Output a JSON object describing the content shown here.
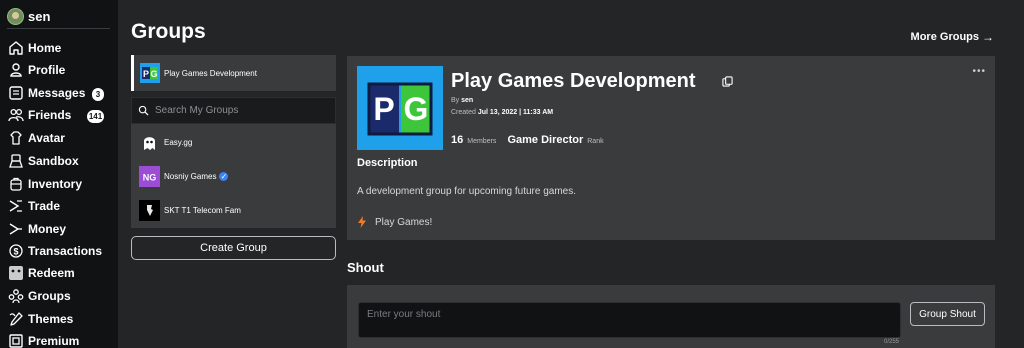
{
  "user": {
    "name": "sen"
  },
  "sidebar": {
    "items": [
      {
        "label": "Home",
        "icon": "home-icon"
      },
      {
        "label": "Profile",
        "icon": "profile-icon"
      },
      {
        "label": "Messages",
        "icon": "messages-icon",
        "badge": "3"
      },
      {
        "label": "Friends",
        "icon": "friends-icon",
        "badge": "141"
      },
      {
        "label": "Avatar",
        "icon": "avatar-icon"
      },
      {
        "label": "Sandbox",
        "icon": "sandbox-icon"
      },
      {
        "label": "Inventory",
        "icon": "inventory-icon"
      },
      {
        "label": "Trade",
        "icon": "trade-icon"
      },
      {
        "label": "Money",
        "icon": "money-icon"
      },
      {
        "label": "Transactions",
        "icon": "transactions-icon"
      },
      {
        "label": "Redeem",
        "icon": "redeem-icon"
      },
      {
        "label": "Groups",
        "icon": "groups-icon"
      },
      {
        "label": "Themes",
        "icon": "themes-icon"
      },
      {
        "label": "Premium",
        "icon": "premium-icon"
      }
    ]
  },
  "header": {
    "title": "Groups",
    "more_groups": "More Groups",
    "more_groups_icon": "arrow-right-icon"
  },
  "group_list": {
    "selected": {
      "name": "Play Games Development"
    },
    "search_placeholder": "Search My Groups",
    "groups": [
      {
        "name": "Easy.gg"
      },
      {
        "name": "Nosniy Games",
        "verified": true
      },
      {
        "name": "SKT T1 Telecom Fam"
      }
    ],
    "create_label": "Create Group"
  },
  "group_info": {
    "name": "Play Games Development",
    "by_label": "By",
    "owner": "sen",
    "created_label": "Created",
    "created": "Jul 13, 2022 | 11:33 AM",
    "members": "16",
    "members_label": "Members",
    "rank": "Game Director",
    "rank_label": "Rank",
    "description_heading": "Description",
    "description": "A development group for upcoming future games.",
    "link_label": "Play Games!",
    "menu_glyph": "•••"
  },
  "shout": {
    "heading": "Shout",
    "placeholder": "Enter your shout",
    "counter": "0/255",
    "button": "Group Shout"
  },
  "colors": {
    "background": "#232527",
    "sidebar": "#111214",
    "card": "#393b3d",
    "brand_blue": "#1ea1ea",
    "link_orange": "#f07b2b"
  }
}
